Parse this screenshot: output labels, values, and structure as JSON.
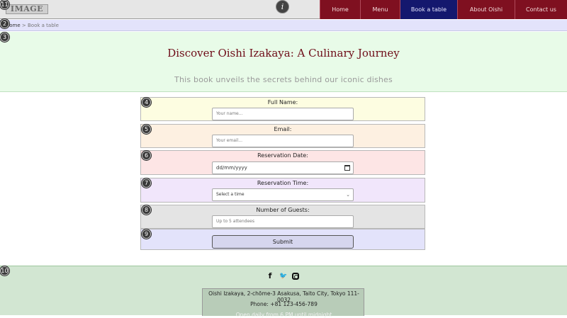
{
  "header": {
    "logo_text": "IMAGE",
    "info_icon": "i",
    "nav": [
      {
        "label": "Home"
      },
      {
        "label": "Menu"
      },
      {
        "label": "Book a table"
      },
      {
        "label": "About Oishi"
      },
      {
        "label": "Contact us"
      }
    ]
  },
  "markers": [
    "11",
    "2",
    "3",
    "4",
    "5",
    "6",
    "7",
    "8",
    "9",
    "10"
  ],
  "breadcrumb": {
    "home": "Home",
    "separator": " > ",
    "current": "Book a table"
  },
  "hero": {
    "title": "Discover Oishi Izakaya: A Culinary Journey",
    "subtitle": "This book unveils the secrets behind our iconic dishes"
  },
  "form": {
    "full_name_label": "Full Name:",
    "full_name_placeholder": "Your name...",
    "email_label": "Email:",
    "email_placeholder": "Your email...",
    "date_label": "Reservation Date:",
    "date_value": "dd/mm/yyyy",
    "time_label": "Reservation Time:",
    "time_selected": "Select a time",
    "guests_label": "Number of Guests:",
    "guests_placeholder": "Up to 5 attendees",
    "submit_label": "Submit"
  },
  "footer": {
    "social_icons": [
      "facebook-icon",
      "twitter-icon",
      "instagram-icon"
    ],
    "facebook_glyph": "f",
    "twitter_glyph": "🐦",
    "address": "Oishi Izakaya, 2-chōme-3 Asakusa, Taito City, Tokyo 111-0032",
    "phone": "Phone: +81 123-456-789",
    "hours": "Open daily from 6 PM until midnight"
  },
  "colors": {
    "nav_bg": "#7f1020",
    "nav_active_bg": "#14186e",
    "title_color": "#6e0c18"
  }
}
